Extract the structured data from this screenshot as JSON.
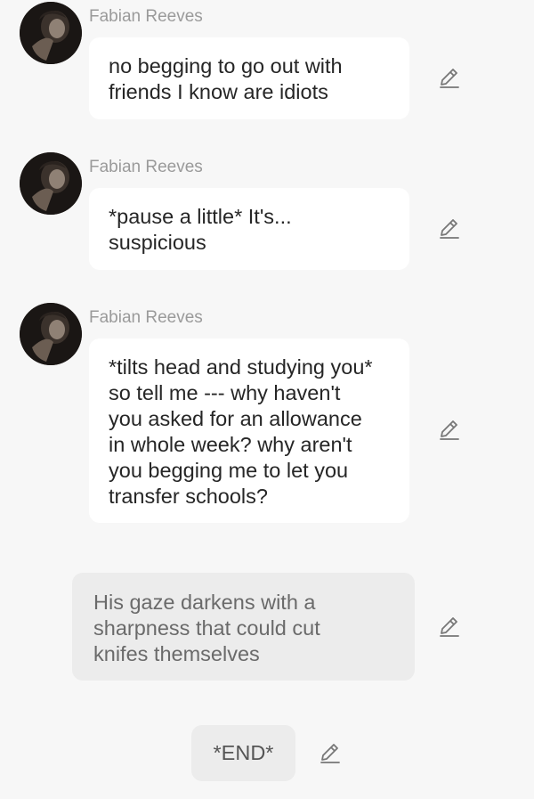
{
  "messages": [
    {
      "sender": "Fabian Reeves",
      "lines": [
        "no begging to go out with",
        "friends I know are idiots"
      ]
    },
    {
      "sender": "Fabian Reeves",
      "lines": [
        "*pause a little* It's...",
        "suspicious"
      ]
    },
    {
      "sender": "Fabian Reeves",
      "lines": [
        "*tilts head and studying you*",
        "so tell me --- why haven't",
        "you asked for an allowance",
        "in whole week? why aren't",
        "you begging me to let you",
        "transfer schools?"
      ]
    }
  ],
  "narration": {
    "lines": [
      "His gaze darkens with a",
      "sharpness that could cut",
      "knifes themselves"
    ]
  },
  "end_label": "*END*",
  "icons": {
    "edit": "pencil-edit-icon"
  }
}
